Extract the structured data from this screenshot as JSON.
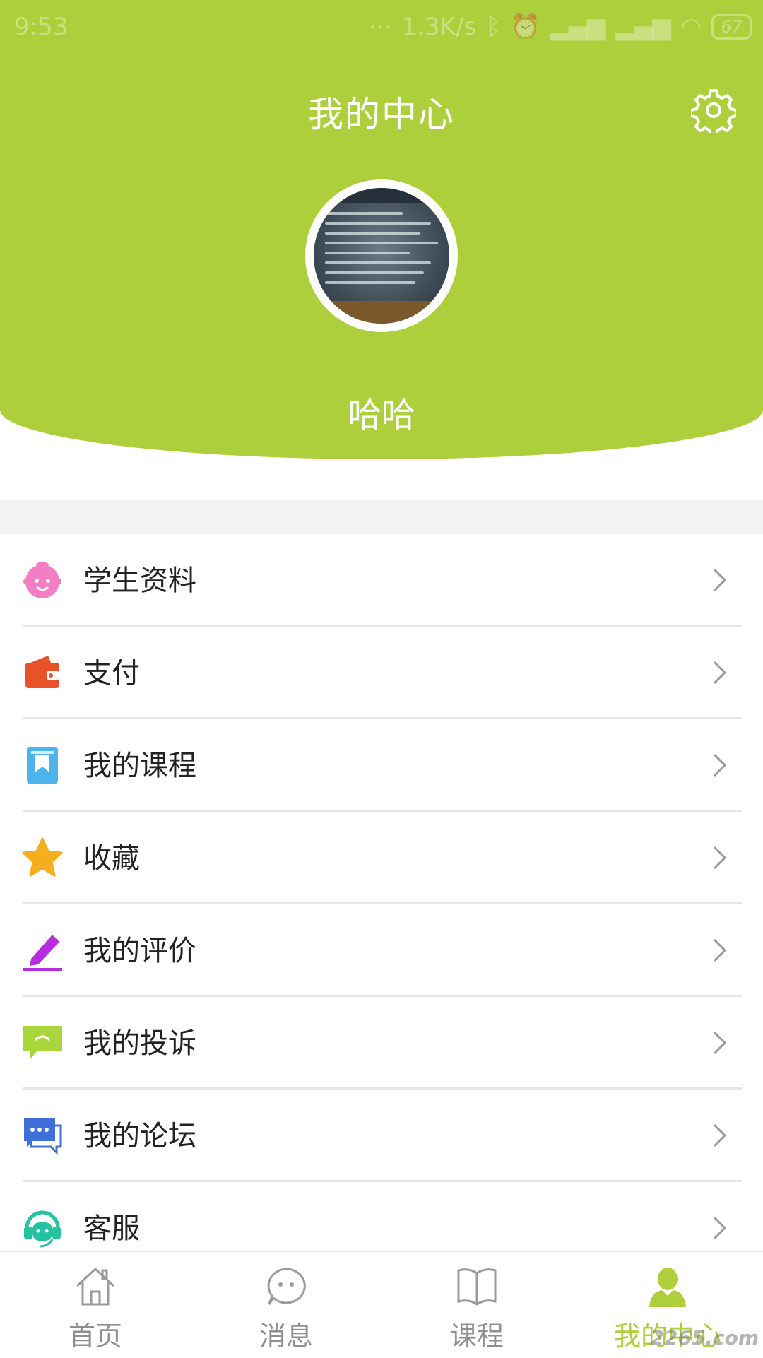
{
  "status_bar": {
    "time": "9:53",
    "network_speed": "1.3K/s",
    "battery": "67"
  },
  "header": {
    "title": "我的中心",
    "username": "哈哈",
    "settings_icon": "gear-icon"
  },
  "colors": {
    "accent": "#aecf3c",
    "student_icon": "#f27fc3",
    "pay_icon": "#e8522a",
    "course_icon": "#4cb3ec",
    "favorite_icon": "#f6ad1e",
    "review_icon": "#b72ce0",
    "complaint_icon": "#a9d63a",
    "forum_icon": "#3f6fd8",
    "service_icon": "#23c3a1"
  },
  "menu": {
    "items": [
      {
        "label": "学生资料",
        "icon": "baby-face-icon"
      },
      {
        "label": "支付",
        "icon": "wallet-icon"
      },
      {
        "label": "我的课程",
        "icon": "bookmark-book-icon"
      },
      {
        "label": "收藏",
        "icon": "star-icon"
      },
      {
        "label": "我的评价",
        "icon": "pencil-icon"
      },
      {
        "label": "我的投诉",
        "icon": "chat-bubble-icon"
      },
      {
        "label": "我的论坛",
        "icon": "forum-icon"
      },
      {
        "label": "客服",
        "icon": "headset-icon"
      }
    ]
  },
  "tabs": [
    {
      "label": "首页",
      "icon": "home-icon",
      "active": false
    },
    {
      "label": "消息",
      "icon": "message-icon",
      "active": false
    },
    {
      "label": "课程",
      "icon": "book-icon",
      "active": false
    },
    {
      "label": "我的中心",
      "icon": "person-icon",
      "active": true
    }
  ],
  "watermark": "2265.com"
}
